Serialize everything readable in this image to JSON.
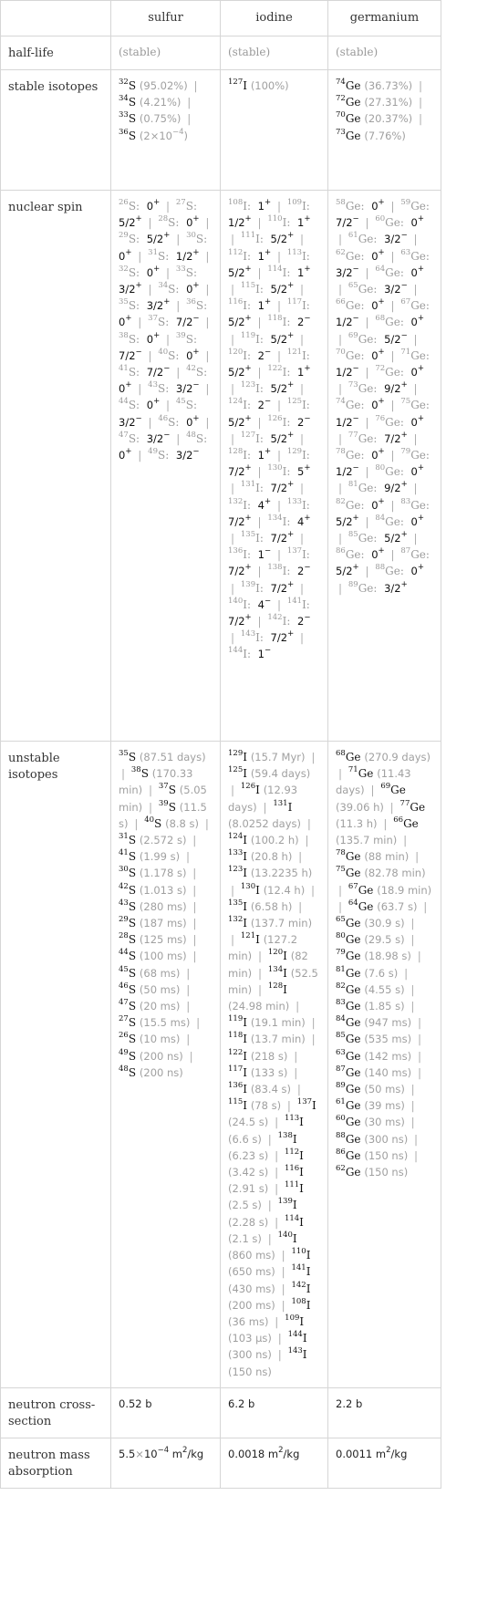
{
  "columns": [
    "",
    "sulfur",
    "iodine",
    "germanium"
  ],
  "rows": {
    "half_life": {
      "label": "half-life",
      "values": [
        "(stable)",
        "(stable)",
        "(stable)"
      ]
    },
    "stable_isotopes": {
      "label": "stable isotopes",
      "sulfur": [
        {
          "mass": "32",
          "sym": "S",
          "abundance": "(95.02%)"
        },
        {
          "mass": "34",
          "sym": "S",
          "abundance": "(4.21%)"
        },
        {
          "mass": "33",
          "sym": "S",
          "abundance": "(0.75%)"
        },
        {
          "mass": "36",
          "sym": "S",
          "abundance": "(2×10^-4)"
        }
      ],
      "iodine": [
        {
          "mass": "127",
          "sym": "I",
          "abundance": "(100%)"
        }
      ],
      "germanium": [
        {
          "mass": "74",
          "sym": "Ge",
          "abundance": "(36.73%)"
        },
        {
          "mass": "72",
          "sym": "Ge",
          "abundance": "(27.31%)"
        },
        {
          "mass": "70",
          "sym": "Ge",
          "abundance": "(20.37%)"
        },
        {
          "mass": "73",
          "sym": "Ge",
          "abundance": "(7.76%)"
        }
      ]
    },
    "nuclear_spin": {
      "label": "nuclear spin",
      "sulfur": [
        [
          "26",
          "0+"
        ],
        [
          "27",
          "5/2+"
        ],
        [
          "28",
          "0+"
        ],
        [
          "29",
          "5/2+"
        ],
        [
          "30",
          "0+"
        ],
        [
          "31",
          "1/2+"
        ],
        [
          "32",
          "0+"
        ],
        [
          "33",
          "3/2+"
        ],
        [
          "34",
          "0+"
        ],
        [
          "35",
          "3/2+"
        ],
        [
          "36",
          "0+"
        ],
        [
          "37",
          "7/2-"
        ],
        [
          "38",
          "0+"
        ],
        [
          "39",
          "7/2-"
        ],
        [
          "40",
          "0+"
        ],
        [
          "41",
          "7/2-"
        ],
        [
          "42",
          "0+"
        ],
        [
          "43",
          "3/2-"
        ],
        [
          "44",
          "0+"
        ],
        [
          "45",
          "3/2-"
        ],
        [
          "46",
          "0+"
        ],
        [
          "47",
          "3/2-"
        ],
        [
          "48",
          "0+"
        ],
        [
          "49",
          "3/2-"
        ]
      ],
      "iodine": [
        [
          "108",
          "1+"
        ],
        [
          "109",
          "1/2+"
        ],
        [
          "110",
          "1+"
        ],
        [
          "111",
          "5/2+"
        ],
        [
          "112",
          "1+"
        ],
        [
          "113",
          "5/2+"
        ],
        [
          "114",
          "1+"
        ],
        [
          "115",
          "5/2+"
        ],
        [
          "116",
          "1+"
        ],
        [
          "117",
          "5/2+"
        ],
        [
          "118",
          "2-"
        ],
        [
          "119",
          "5/2+"
        ],
        [
          "120",
          "2-"
        ],
        [
          "121",
          "5/2+"
        ],
        [
          "122",
          "1+"
        ],
        [
          "123",
          "5/2+"
        ],
        [
          "124",
          "2-"
        ],
        [
          "125",
          "5/2+"
        ],
        [
          "126",
          "2-"
        ],
        [
          "127",
          "5/2+"
        ],
        [
          "128",
          "1+"
        ],
        [
          "129",
          "7/2+"
        ],
        [
          "130",
          "5+"
        ],
        [
          "131",
          "7/2+"
        ],
        [
          "132",
          "4+"
        ],
        [
          "133",
          "7/2+"
        ],
        [
          "134",
          "4+"
        ],
        [
          "135",
          "7/2+"
        ],
        [
          "136",
          "1-"
        ],
        [
          "137",
          "7/2+"
        ],
        [
          "138",
          "2-"
        ],
        [
          "139",
          "7/2+"
        ],
        [
          "140",
          "4-"
        ],
        [
          "141",
          "7/2+"
        ],
        [
          "142",
          "2-"
        ],
        [
          "143",
          "7/2+"
        ],
        [
          "144",
          "1-"
        ]
      ],
      "germanium": [
        [
          "58",
          "0+"
        ],
        [
          "59",
          "7/2-"
        ],
        [
          "60",
          "0+"
        ],
        [
          "61",
          "3/2-"
        ],
        [
          "62",
          "0+"
        ],
        [
          "63",
          "3/2-"
        ],
        [
          "64",
          "0+"
        ],
        [
          "65",
          "3/2-"
        ],
        [
          "66",
          "0+"
        ],
        [
          "67",
          "1/2-"
        ],
        [
          "68",
          "0+"
        ],
        [
          "69",
          "5/2-"
        ],
        [
          "70",
          "0+"
        ],
        [
          "71",
          "1/2-"
        ],
        [
          "72",
          "0+"
        ],
        [
          "73",
          "9/2+"
        ],
        [
          "74",
          "0+"
        ],
        [
          "75",
          "1/2-"
        ],
        [
          "76",
          "0+"
        ],
        [
          "77",
          "7/2+"
        ],
        [
          "78",
          "0+"
        ],
        [
          "79",
          "1/2-"
        ],
        [
          "80",
          "0+"
        ],
        [
          "81",
          "9/2+"
        ],
        [
          "82",
          "0+"
        ],
        [
          "83",
          "5/2+"
        ],
        [
          "84",
          "0+"
        ],
        [
          "85",
          "5/2+"
        ],
        [
          "86",
          "0+"
        ],
        [
          "87",
          "5/2+"
        ],
        [
          "88",
          "0+"
        ],
        [
          "89",
          "3/2+"
        ]
      ]
    },
    "unstable_isotopes": {
      "label": "unstable isotopes",
      "sulfur": [
        [
          "35",
          "(87.51 days)"
        ],
        [
          "38",
          "(170.33 min)"
        ],
        [
          "37",
          "(5.05 min)"
        ],
        [
          "39",
          "(11.5 s)"
        ],
        [
          "40",
          "(8.8 s)"
        ],
        [
          "31",
          "(2.572 s)"
        ],
        [
          "41",
          "(1.99 s)"
        ],
        [
          "30",
          "(1.178 s)"
        ],
        [
          "42",
          "(1.013 s)"
        ],
        [
          "43",
          "(280 ms)"
        ],
        [
          "29",
          "(187 ms)"
        ],
        [
          "28",
          "(125 ms)"
        ],
        [
          "44",
          "(100 ms)"
        ],
        [
          "45",
          "(68 ms)"
        ],
        [
          "46",
          "(50 ms)"
        ],
        [
          "47",
          "(20 ms)"
        ],
        [
          "27",
          "(15.5 ms)"
        ],
        [
          "26",
          "(10 ms)"
        ],
        [
          "49",
          "(200 ns)"
        ],
        [
          "48",
          "(200 ns)"
        ]
      ],
      "iodine": [
        [
          "129",
          "(15.7 Myr)"
        ],
        [
          "125",
          "(59.4 days)"
        ],
        [
          "126",
          "(12.93 days)"
        ],
        [
          "131",
          "(8.0252 days)"
        ],
        [
          "124",
          "(100.2 h)"
        ],
        [
          "133",
          "(20.8 h)"
        ],
        [
          "123",
          "(13.2235 h)"
        ],
        [
          "130",
          "(12.4 h)"
        ],
        [
          "135",
          "(6.58 h)"
        ],
        [
          "132",
          "(137.7 min)"
        ],
        [
          "121",
          "(127.2 min)"
        ],
        [
          "120",
          "(82 min)"
        ],
        [
          "134",
          "(52.5 min)"
        ],
        [
          "128",
          "(24.98 min)"
        ],
        [
          "119",
          "(19.1 min)"
        ],
        [
          "118",
          "(13.7 min)"
        ],
        [
          "122",
          "(218 s)"
        ],
        [
          "117",
          "(133 s)"
        ],
        [
          "136",
          "(83.4 s)"
        ],
        [
          "115",
          "(78 s)"
        ],
        [
          "137",
          "(24.5 s)"
        ],
        [
          "113",
          "(6.6 s)"
        ],
        [
          "138",
          "(6.23 s)"
        ],
        [
          "112",
          "(3.42 s)"
        ],
        [
          "116",
          "(2.91 s)"
        ],
        [
          "111",
          "(2.5 s)"
        ],
        [
          "139",
          "(2.28 s)"
        ],
        [
          "114",
          "(2.1 s)"
        ],
        [
          "140",
          "(860 ms)"
        ],
        [
          "110",
          "(650 ms)"
        ],
        [
          "141",
          "(430 ms)"
        ],
        [
          "142",
          "(200 ms)"
        ],
        [
          "108",
          "(36 ms)"
        ],
        [
          "109",
          "(103 μs)"
        ],
        [
          "144",
          "(300 ns)"
        ],
        [
          "143",
          "(150 ns)"
        ]
      ],
      "germanium": [
        [
          "68",
          "(270.9 days)"
        ],
        [
          "71",
          "(11.43 days)"
        ],
        [
          "69",
          "(39.06 h)"
        ],
        [
          "77",
          "(11.3 h)"
        ],
        [
          "66",
          "(135.7 min)"
        ],
        [
          "78",
          "(88 min)"
        ],
        [
          "75",
          "(82.78 min)"
        ],
        [
          "67",
          "(18.9 min)"
        ],
        [
          "64",
          "(63.7 s)"
        ],
        [
          "65",
          "(30.9 s)"
        ],
        [
          "80",
          "(29.5 s)"
        ],
        [
          "79",
          "(18.98 s)"
        ],
        [
          "81",
          "(7.6 s)"
        ],
        [
          "82",
          "(4.55 s)"
        ],
        [
          "83",
          "(1.85 s)"
        ],
        [
          "84",
          "(947 ms)"
        ],
        [
          "85",
          "(535 ms)"
        ],
        [
          "63",
          "(142 ms)"
        ],
        [
          "87",
          "(140 ms)"
        ],
        [
          "89",
          "(50 ms)"
        ],
        [
          "61",
          "(39 ms)"
        ],
        [
          "60",
          "(30 ms)"
        ],
        [
          "88",
          "(300 ns)"
        ],
        [
          "86",
          "(150 ns)"
        ],
        [
          "62",
          "(150 ns)"
        ]
      ]
    },
    "neutron_cross_section": {
      "label": "neutron cross-section",
      "values": [
        "0.52 b",
        "6.2 b",
        "2.2 b"
      ]
    },
    "neutron_mass_absorption": {
      "label": "neutron mass absorption",
      "values": [
        {
          "mantissa": "5.5",
          "times": "×10",
          "exp": "-4",
          "unit": "m",
          "unit_exp": "2",
          "unit_rest": "/kg"
        },
        {
          "mantissa": "0.0018",
          "times": "",
          "exp": "",
          "unit": "m",
          "unit_exp": "2",
          "unit_rest": "/kg"
        },
        {
          "mantissa": "0.0011",
          "times": "",
          "exp": "",
          "unit": "m",
          "unit_exp": "2",
          "unit_rest": "/kg"
        }
      ]
    }
  },
  "symbols": {
    "sulfur": "S",
    "iodine": "I",
    "germanium": "Ge"
  },
  "colors": {
    "border": "#d6d6d6",
    "muted": "#9a9a9a",
    "text": "#222222"
  }
}
